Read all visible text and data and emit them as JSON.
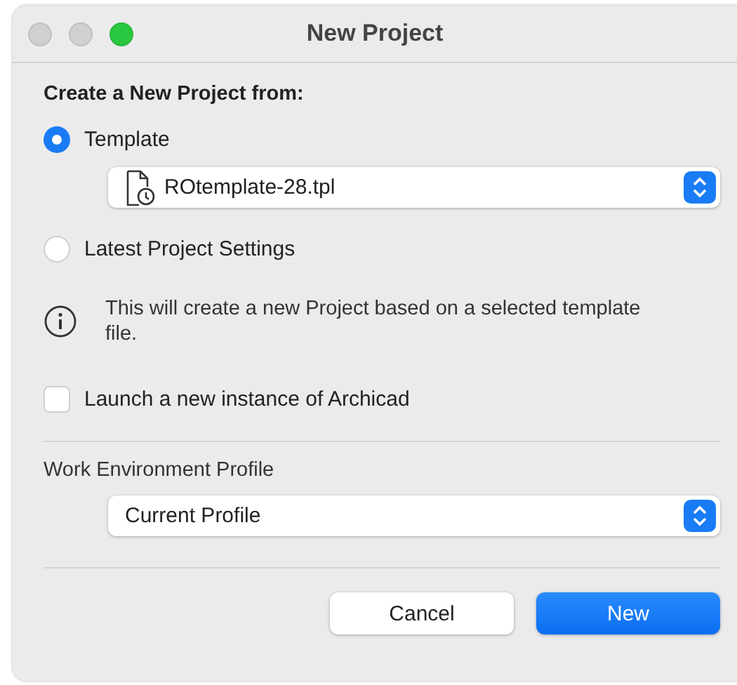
{
  "window": {
    "title": "New Project",
    "controls": [
      {
        "kind": "close"
      },
      {
        "kind": "minimize"
      },
      {
        "kind": "zoom"
      }
    ]
  },
  "source": {
    "heading": "Create a New Project from:",
    "options": [
      {
        "label": "Template",
        "selected": true,
        "popup": {
          "value": "ROtemplate-28.tpl"
        }
      },
      {
        "label": "Latest Project Settings",
        "selected": false
      }
    ]
  },
  "info": "This will create a new Project based on a selected template file.",
  "launch_new_instance": {
    "label": "Launch a new instance of Archicad",
    "checked": false
  },
  "profile": {
    "label": "Work Environment Profile",
    "popup": {
      "value": "Current Profile"
    }
  },
  "buttons": [
    {
      "label": "Cancel",
      "kind": "default"
    },
    {
      "label": "New",
      "kind": "primary"
    }
  ]
}
